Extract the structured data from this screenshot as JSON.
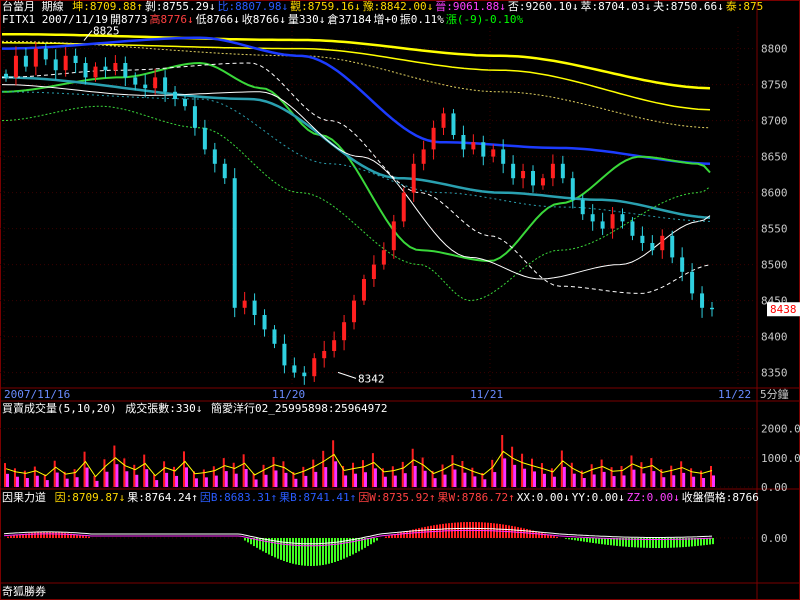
{
  "header": {
    "title": "台當月 期線",
    "stats": [
      {
        "label": "坤:8709.88↑",
        "color": "#ffd800"
      },
      {
        "label": "剝:8755.29↓",
        "color": "#ffffff"
      },
      {
        "label": "比:8807.98↓",
        "color": "#2a5cff"
      },
      {
        "label": "觀:8759.16↓",
        "color": "#ffd800"
      },
      {
        "label": "豫:8842.00↓",
        "color": "#ffd800"
      },
      {
        "label": "晉:9061.88↓",
        "color": "#ff40ff"
      },
      {
        "label": "否:9260.10↓",
        "color": "#ffffff"
      },
      {
        "label": "萃:8704.03↓",
        "color": "#ffffff"
      },
      {
        "label": "夬:8750.66↓",
        "color": "#ffffff"
      },
      {
        "label": "泰:875",
        "color": "#ffd800"
      }
    ],
    "quote": [
      {
        "label": "FITX1 2007/11/19",
        "color": "#ffffff"
      },
      {
        "label": "開8773",
        "color": "#ffffff"
      },
      {
        "label": "高8776↓",
        "color": "#ff4040"
      },
      {
        "label": "低8766↓",
        "color": "#ffffff"
      },
      {
        "label": "收8766↓",
        "color": "#ffffff"
      },
      {
        "label": "量330↓",
        "color": "#ffffff"
      },
      {
        "label": "倉37184",
        "color": "#ffffff"
      },
      {
        "label": "增+0",
        "color": "#ffffff"
      },
      {
        "label": "振0.11%",
        "color": "#ffffff"
      },
      {
        "label": "漲(-9)-0.10%",
        "color": "#00ff00"
      }
    ]
  },
  "price_panel": {
    "y_ticks": [
      "8800",
      "8750",
      "8700",
      "8650",
      "8600",
      "8550",
      "8500",
      "8450",
      "8400",
      "8350"
    ],
    "high_label": "8825",
    "low_label": "8342",
    "last_price_tag": "8438",
    "dates": [
      "2007/11/16",
      "11/20",
      "11/21",
      "11/22"
    ],
    "interval": "5分鐘"
  },
  "volume_panel": {
    "label": "買賣成交量(5,10,20)",
    "count_label": "成交張數:330↓",
    "source_label": "簡愛洋行02_25995898:25964972",
    "y_ticks": [
      "2000.0",
      "1000.0",
      "0.00"
    ]
  },
  "indicator_panel": {
    "name": "因果力道",
    "values": [
      {
        "label": "因:8709.87↓",
        "color": "#ffd800"
      },
      {
        "label": "果:8764.24↑",
        "color": "#ffffff"
      },
      {
        "label": "因B:8683.31↑",
        "color": "#2a5cff"
      },
      {
        "label": "果B:8741.41↑",
        "color": "#2a5cff"
      },
      {
        "label": "因W:8735.92↑",
        "color": "#ff4040"
      },
      {
        "label": "果W:8786.72↑",
        "color": "#ff4040"
      },
      {
        "label": "XX:0.00↓",
        "color": "#ffffff"
      },
      {
        "label": "YY:0.00↓",
        "color": "#ffffff"
      },
      {
        "label": "ZZ:0.00↓",
        "color": "#ff40ff"
      },
      {
        "label": "收盤價格:8766",
        "color": "#ffffff"
      }
    ],
    "y_tick": "0.00"
  },
  "footer": {
    "brand": "奇狐勝券"
  },
  "colors": {
    "up": "#ff2020",
    "down": "#2fd0e0",
    "ma_yellow": "#ffff00",
    "ma_blue": "#1c3cff",
    "ma_green": "#3ad83a",
    "ma_teal": "#2aa0b0",
    "grid": "#7a0000",
    "pink": "#ff30ff",
    "green_hist": "#40ff20",
    "red_hist": "#ff2020"
  },
  "chart_data": {
    "type": "candlestick",
    "interval": "5分鐘",
    "ylim": [
      8330,
      8830
    ],
    "y_ticks": [
      8800,
      8750,
      8700,
      8650,
      8600,
      8550,
      8500,
      8450,
      8400,
      8350
    ],
    "x_labels": [
      "2007/11/16",
      "11/20",
      "11/21",
      "11/22"
    ],
    "annotated_high": 8825,
    "annotated_low": 8342,
    "last_price": 8438,
    "close_path": [
      8760,
      8790,
      8775,
      8800,
      8785,
      8770,
      8790,
      8780,
      8760,
      8775,
      8770,
      8780,
      8760,
      8750,
      8745,
      8760,
      8740,
      8730,
      8720,
      8690,
      8660,
      8640,
      8620,
      8440,
      8450,
      8430,
      8410,
      8390,
      8360,
      8350,
      8345,
      8370,
      8380,
      8395,
      8420,
      8450,
      8480,
      8500,
      8520,
      8560,
      8600,
      8640,
      8660,
      8690,
      8710,
      8680,
      8660,
      8670,
      8650,
      8660,
      8640,
      8620,
      8630,
      8610,
      8620,
      8640,
      8620,
      8590,
      8570,
      8560,
      8550,
      8570,
      8560,
      8540,
      8530,
      8520,
      8540,
      8510,
      8490,
      8460,
      8440,
      8438
    ],
    "volume_ylim": [
      0,
      2500
    ],
    "volume_ticks": [
      2000,
      1000,
      0
    ],
    "volume_close_levels": [
      820,
      640,
      560,
      700,
      430,
      900,
      520,
      610,
      1210,
      380,
      950,
      1420,
      980,
      760,
      1110,
      430,
      880,
      690,
      1220,
      540,
      600,
      710,
      990,
      830,
      1120,
      470,
      760,
      1030,
      880,
      510,
      690,
      940,
      1240,
      1600,
      720,
      830,
      920,
      1160,
      640,
      710,
      860,
      1310,
      1010,
      550,
      770,
      1090,
      890,
      660,
      480,
      930,
      1780,
      1380,
      1140,
      970,
      820,
      640,
      1250,
      830,
      560,
      780,
      940,
      680,
      720,
      1080,
      850,
      990,
      610,
      730,
      880,
      640,
      560,
      720
    ]
  }
}
